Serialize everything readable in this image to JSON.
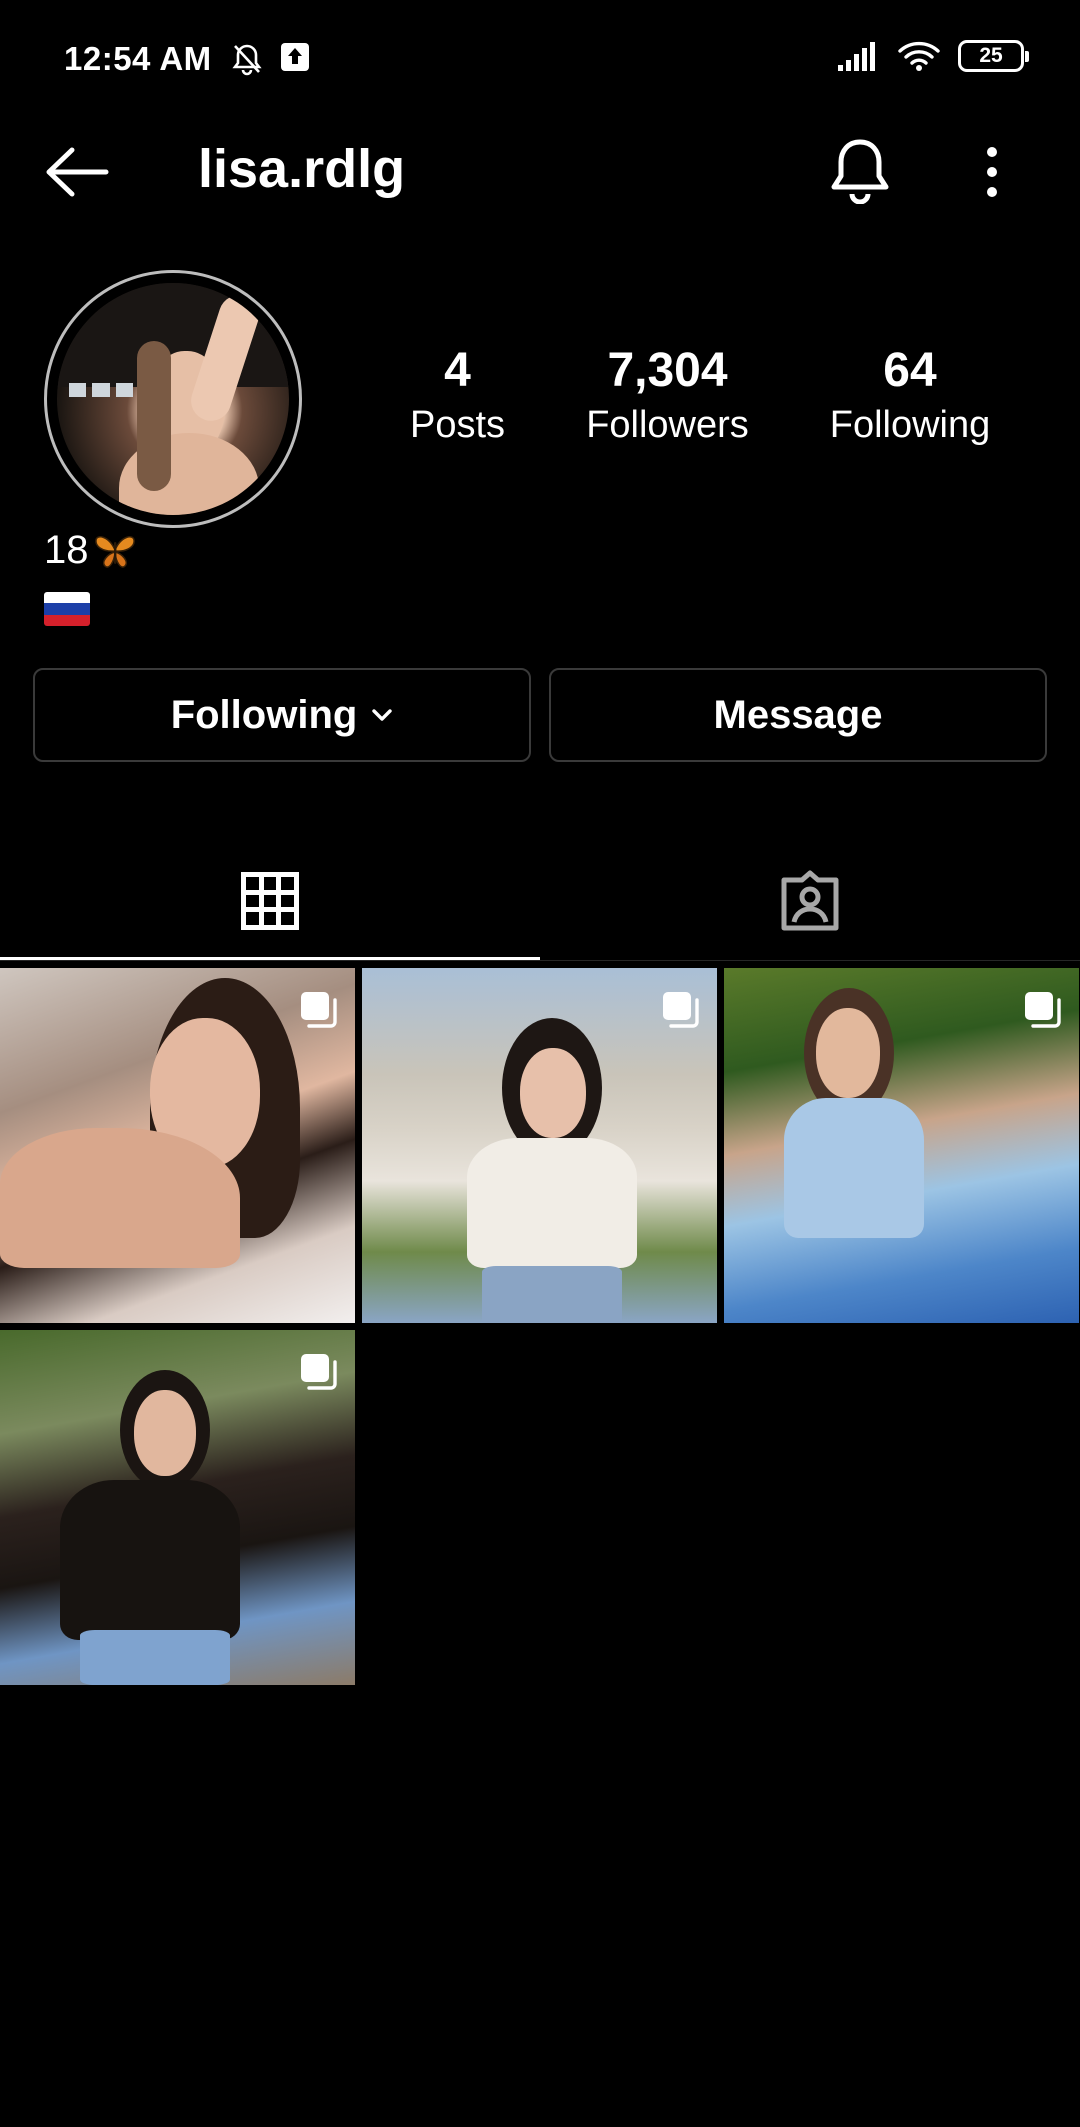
{
  "status_bar": {
    "time": "12:54 AM",
    "battery": "25",
    "icons": [
      "notifications-muted-icon",
      "upload-icon",
      "signal-icon",
      "wifi-icon",
      "battery-icon"
    ]
  },
  "header": {
    "username": "lisa.rdlg",
    "icons": [
      "back-arrow-icon",
      "bell-icon",
      "more-vertical-icon"
    ]
  },
  "profile": {
    "stats": [
      {
        "value": "4",
        "label": "Posts"
      },
      {
        "value": "7,304",
        "label": "Followers"
      },
      {
        "value": "64",
        "label": "Following"
      }
    ],
    "bio_text": "18",
    "bio_emoji": "butterfly",
    "flag": "russia-flag"
  },
  "actions": {
    "following_label": "Following",
    "message_label": "Message"
  },
  "tabs": [
    {
      "icon": "grid-icon",
      "active": true
    },
    {
      "icon": "tagged-person-icon",
      "active": false
    }
  ],
  "posts": [
    {
      "multiple": true
    },
    {
      "multiple": true
    },
    {
      "multiple": true
    },
    {
      "multiple": true
    }
  ],
  "colors": {
    "background": "#000000",
    "text": "#ffffff",
    "button_border": "#3a3a3a",
    "tab_inactive": "#a8a8a8"
  }
}
